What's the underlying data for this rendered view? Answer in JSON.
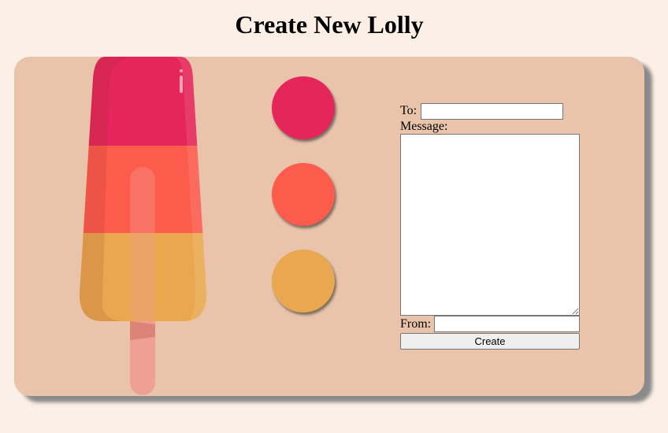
{
  "page": {
    "title": "Create New Lolly"
  },
  "colors": {
    "background": "#fcefe6",
    "card": "#e9c4aa",
    "flavour_top": "#e5265a",
    "flavour_middle": "#fd5b4c",
    "flavour_bottom": "#e9a74f",
    "stick": "#eea193"
  },
  "lolly": {
    "icon": "lolly-icon",
    "flavours": [
      "#e5265a",
      "#fd5b4c",
      "#e9a74f"
    ]
  },
  "form": {
    "to_label": "To:",
    "to_value": "",
    "message_label": "Message:",
    "message_value": "",
    "from_label": "From:",
    "from_value": "",
    "submit_label": "Create"
  }
}
